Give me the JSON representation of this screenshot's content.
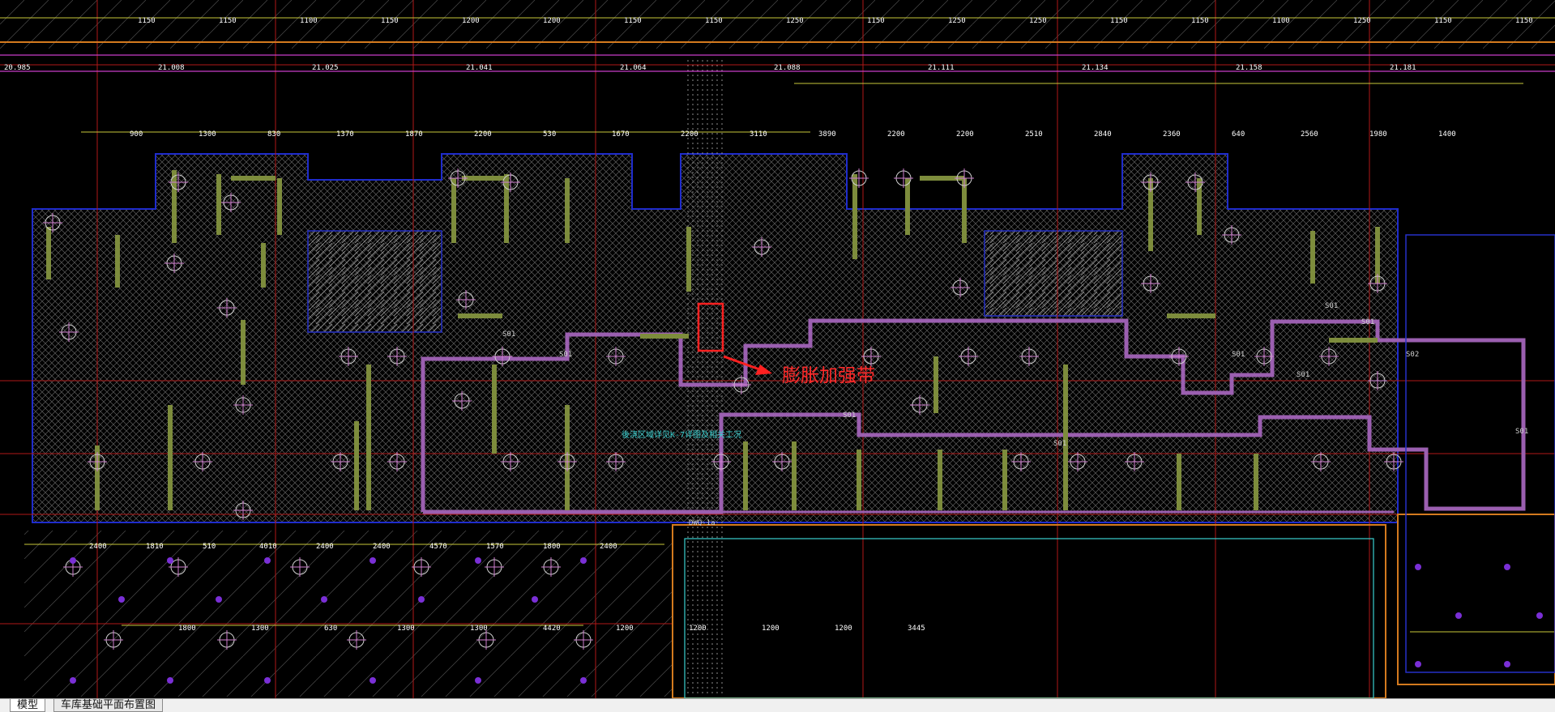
{
  "drawing": {
    "annotation_text": "膨胀加强带",
    "band_elevations": [
      "20.985",
      "21.008",
      "21.025",
      "21.041",
      "21.064",
      "21.088",
      "21.111",
      "21.134",
      "21.158",
      "21.181"
    ],
    "top_dims": [
      "1150",
      "1150",
      "1100",
      "1150",
      "1200",
      "1200",
      "1150",
      "1150",
      "1250",
      "1150",
      "1250",
      "1250",
      "1150",
      "1150",
      "1100",
      "1250",
      "1150",
      "1150"
    ],
    "mid_dims": [
      "900",
      "1300",
      "830",
      "1370",
      "1870",
      "2200",
      "530",
      "1670",
      "2200",
      "3110",
      "3890",
      "2200",
      "2200",
      "2510",
      "2840",
      "2360",
      "640",
      "2560",
      "1980",
      "1400"
    ],
    "lower_dims": [
      "2400",
      "1810",
      "510",
      "4010",
      "2400",
      "2400",
      "4570",
      "1570",
      "1800",
      "2400"
    ],
    "bottom_dims": [
      "1800",
      "1300",
      "630",
      "1300",
      "1300",
      "4420",
      "1200",
      "1200",
      "1200",
      "1200",
      "3445"
    ],
    "band_labels": [
      "S01",
      "S01",
      "S01",
      "S01",
      "S01",
      "S01",
      "S01",
      "S01",
      "S02",
      "S01"
    ],
    "region_label": "後浇区域详见K-7详图及相关工况",
    "marker_bottom": "DWQ-1a",
    "colors": {
      "background": "#000000",
      "hatch": "#6e6e6e",
      "slab_outline": "#9b5fb0",
      "wall": "#7d8c3c",
      "red_grid": "#b01818",
      "magenta": "#c83cc8",
      "yellow": "#c8c83a",
      "cyan": "#3ad0d0",
      "blue": "#2530c8",
      "orange": "#d47a1e",
      "annotation": "#ff2a2a"
    }
  },
  "tabs": {
    "model": "模型",
    "layout": "车库基础平面布置图"
  }
}
